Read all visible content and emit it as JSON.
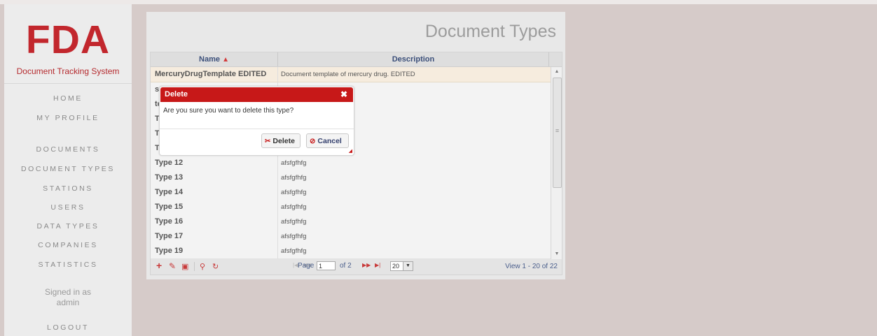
{
  "app": {
    "logo": "FDA",
    "subtitle": "Document Tracking System"
  },
  "sidebar": {
    "items": [
      {
        "label": "HOME"
      },
      {
        "label": "MY PROFILE"
      },
      {
        "label": "DOCUMENTS"
      },
      {
        "label": "DOCUMENT TYPES"
      },
      {
        "label": "STATIONS"
      },
      {
        "label": "USERS"
      },
      {
        "label": "DATA TYPES"
      },
      {
        "label": "COMPANIES"
      },
      {
        "label": "STATISTICS"
      }
    ],
    "signed_in_line1": "Signed in as",
    "signed_in_line2": "admin",
    "logout": "LOGOUT"
  },
  "page": {
    "title": "Document Types"
  },
  "grid": {
    "columns": {
      "name": "Name",
      "description": "Description"
    },
    "sort_icon": "sort-asc-icon",
    "rows": [
      {
        "name": "MercuryDrugTemplate EDITED",
        "description": "Document template of mercury drug. EDITED",
        "selected": true
      },
      {
        "name": "s",
        "description": ""
      },
      {
        "name": "te",
        "description": ""
      },
      {
        "name": "T",
        "description": ""
      },
      {
        "name": "T",
        "description": ""
      },
      {
        "name": "T",
        "description": ""
      },
      {
        "name": "Type 12",
        "description": "afsfgfhfg"
      },
      {
        "name": "Type 13",
        "description": "afsfgfhfg"
      },
      {
        "name": "Type 14",
        "description": "afsfgfhfg"
      },
      {
        "name": "Type 15",
        "description": "afsfgfhfg"
      },
      {
        "name": "Type 16",
        "description": "afsfgfhfg"
      },
      {
        "name": "Type 17",
        "description": "afsfgfhfg"
      },
      {
        "name": "Type 19",
        "description": "afsfgfhfg"
      }
    ]
  },
  "pager": {
    "page_label": "Page",
    "page_value": "1",
    "of_label": "of 2",
    "page_size": "20",
    "view_text": "View 1 - 20 of 22"
  },
  "dialog": {
    "title": "Delete",
    "message": "Are you sure you want to delete this type?",
    "delete_label": "Delete",
    "cancel_label": "Cancel"
  },
  "colors": {
    "brand": "#c2272d",
    "dialog_header": "#c71818",
    "background": "#d6cbc9"
  }
}
